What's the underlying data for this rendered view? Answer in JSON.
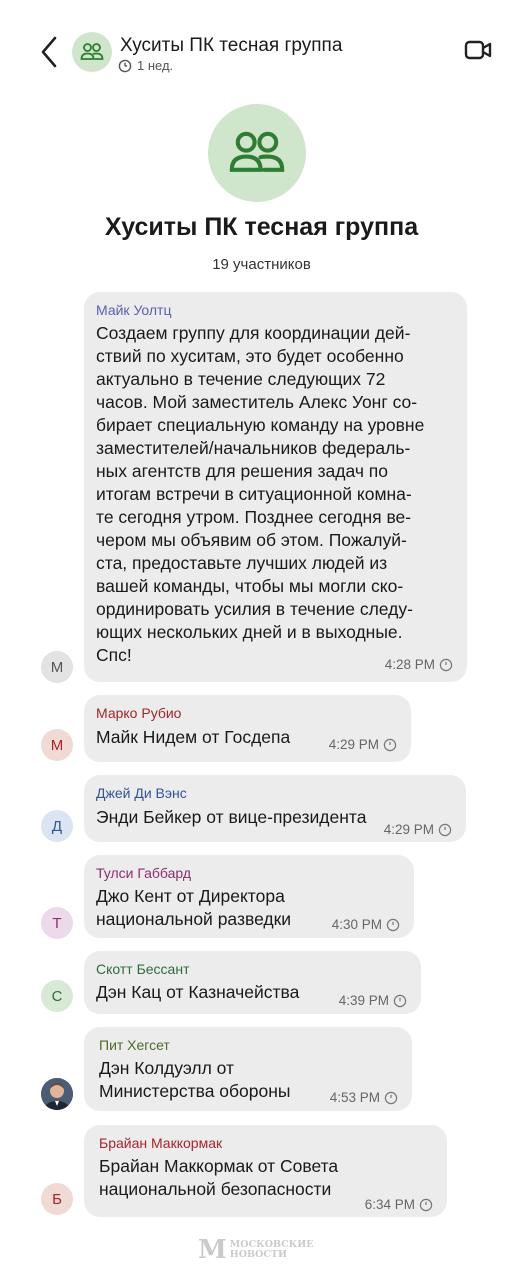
{
  "header": {
    "title": "Хуситы ПК тесная группа",
    "timer_label": "1 нед."
  },
  "group": {
    "title": "Хуситы ПК тесная группа",
    "members": "19 участников"
  },
  "messages": [
    {
      "sender": "Майк Уолтц",
      "sender_color": "#5b5fb0",
      "avatar_letter": "М",
      "avatar_bg": "#e3e3e3",
      "avatar_fg": "#555555",
      "lines": [
        "Создаем группу для координации дей-",
        "ствий по хуситам, это будет особенно",
        "актуально в течение следующих 72",
        "часов. Мой заместитель Алекс Уонг со-",
        "бирает специальную команду на уровне",
        "заместителей/начальников федераль-",
        "ных агентств для решения задач по",
        "итогам встречи в ситуационной комна-",
        "те сегодня утром. Позднее сегодня ве-",
        "чером мы объявим об этом. Пожалуй-",
        "ста, предоставьте лучших людей из",
        "вашей команды, чтобы мы могли ско-",
        "ординировать усилия в течение следу-",
        "ющих нескольких дней и в выходные.",
        "Спс!"
      ],
      "time": "4:28 PM"
    },
    {
      "sender": "Марко Рубио",
      "sender_color": "#a3262a",
      "avatar_letter": "М",
      "avatar_bg": "#f1d9d4",
      "avatar_fg": "#a3262a",
      "lines": [
        "Майк Нидем от Госдепа"
      ],
      "time": "4:29 PM"
    },
    {
      "sender": "Джей Ди Вэнс",
      "sender_color": "#2f5597",
      "avatar_letter": "Д",
      "avatar_bg": "#dbe4f3",
      "avatar_fg": "#2f5597",
      "lines": [
        "Энди Бейкер от вице-президента"
      ],
      "time": "4:29 PM"
    },
    {
      "sender": "Тулси Габбард",
      "sender_color": "#8b2f6e",
      "avatar_letter": "Т",
      "avatar_bg": "#ecdaea",
      "avatar_fg": "#8b2f6e",
      "lines": [
        "Джо Кент от Директора",
        "национальной разведки"
      ],
      "time": "4:30 PM"
    },
    {
      "sender": "Скотт Бессант",
      "sender_color": "#2e6b3a",
      "avatar_letter": "С",
      "avatar_bg": "#d8e9d6",
      "avatar_fg": "#2e6b3a",
      "lines": [
        "Дэн Кац от Казначейства"
      ],
      "time": "4:39 PM"
    },
    {
      "sender": "Пит Хегсет",
      "sender_color": "#4d6b2a",
      "avatar_letter": "",
      "avatar_bg": "#5a6e86",
      "avatar_fg": "#ffffff",
      "lines": [
        "Дэн Колдуэлл от",
        "Министерства обороны"
      ],
      "time": "4:53 PM"
    },
    {
      "sender": "Брайан Маккормак",
      "sender_color": "#a3262a",
      "avatar_letter": "Б",
      "avatar_bg": "#f1d9d4",
      "avatar_fg": "#a3262a",
      "lines": [
        "Брайан Маккормак от Совета",
        "национальной безопасности"
      ],
      "time": "6:34 PM"
    }
  ],
  "watermark": {
    "letter": "М",
    "line1": "МОСКОВСКИЕ",
    "line2": "НОВОСТИ"
  },
  "icons": {
    "back": "chevron-left-icon",
    "group": "group-people-icon",
    "timer": "timer-icon",
    "video": "video-call-icon"
  }
}
